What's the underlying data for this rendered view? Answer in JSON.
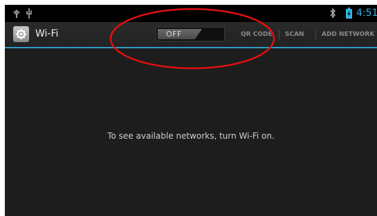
{
  "status_bar": {
    "time": "4:51",
    "icons": [
      "usb-debug-icon",
      "usb-icon",
      "bluetooth-icon",
      "battery-icon"
    ],
    "time_color": "#33b5e5"
  },
  "action_bar": {
    "app_icon": "settings-icon",
    "title": "Wi-Fi",
    "toggle": {
      "label": "OFF",
      "state": "off"
    },
    "actions": {
      "qr_code": "QR CODE",
      "scan": "SCAN",
      "add_network": "ADD NETWORK"
    },
    "accent_color": "#33b5e5"
  },
  "main": {
    "empty_message": "To see available networks, turn Wi-Fi on."
  },
  "annotation": {
    "shape": "ellipse",
    "color": "#e01010"
  }
}
